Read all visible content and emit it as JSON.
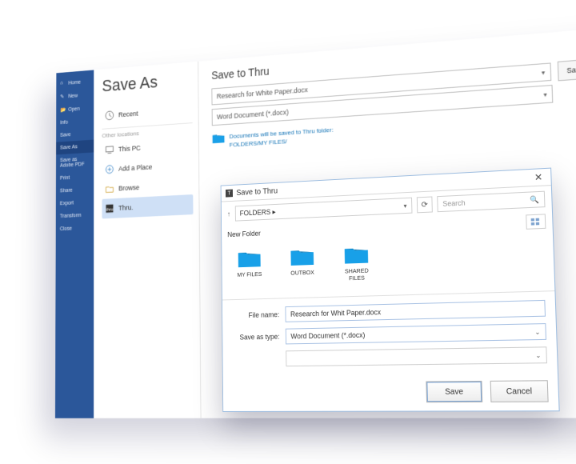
{
  "page_title": "Save As",
  "sidenav": [
    {
      "label": "Home",
      "icon": "home"
    },
    {
      "label": "New",
      "icon": "new"
    },
    {
      "label": "Open",
      "icon": "open"
    },
    {
      "label": "Info",
      "icon": ""
    },
    {
      "label": "Save",
      "icon": ""
    },
    {
      "label": "Save As",
      "icon": "",
      "selected": true
    },
    {
      "label": "Save as Adobe PDF",
      "icon": ""
    },
    {
      "label": "Print",
      "icon": ""
    },
    {
      "label": "Share",
      "icon": ""
    },
    {
      "label": "Export",
      "icon": ""
    },
    {
      "label": "Transform",
      "icon": ""
    },
    {
      "label": "Close",
      "icon": ""
    }
  ],
  "midlist": {
    "recent": "Recent",
    "other_label": "Other locations",
    "items": [
      {
        "label": "This PC",
        "icon": "pc"
      },
      {
        "label": "Add a Place",
        "icon": "addplace"
      },
      {
        "label": "Browse",
        "icon": "browse"
      },
      {
        "label": "Thru.",
        "icon": "thru",
        "selected": true
      }
    ]
  },
  "right": {
    "header": "Save to Thru",
    "filename": "Research for White Paper.docx",
    "filetype": "Word Document (*.docx)",
    "button": "Save to Thru",
    "dest_line1": "Documents will be saved to Thru folder:",
    "dest_line2": "FOLDERS/MY FILES/"
  },
  "dialog": {
    "title": "Save to Thru",
    "path": "FOLDERS ▸",
    "search_placeholder": "Search",
    "new_folder": "New Folder",
    "folders": [
      "MY FILES",
      "OUTBOX",
      "SHARED FILES"
    ],
    "filename_label": "File name:",
    "filename_value": "Research for Whit Paper.docx",
    "savetype_label": "Save as type:",
    "savetype_value": "Word Document (*.docx)",
    "save": "Save",
    "cancel": "Cancel"
  }
}
